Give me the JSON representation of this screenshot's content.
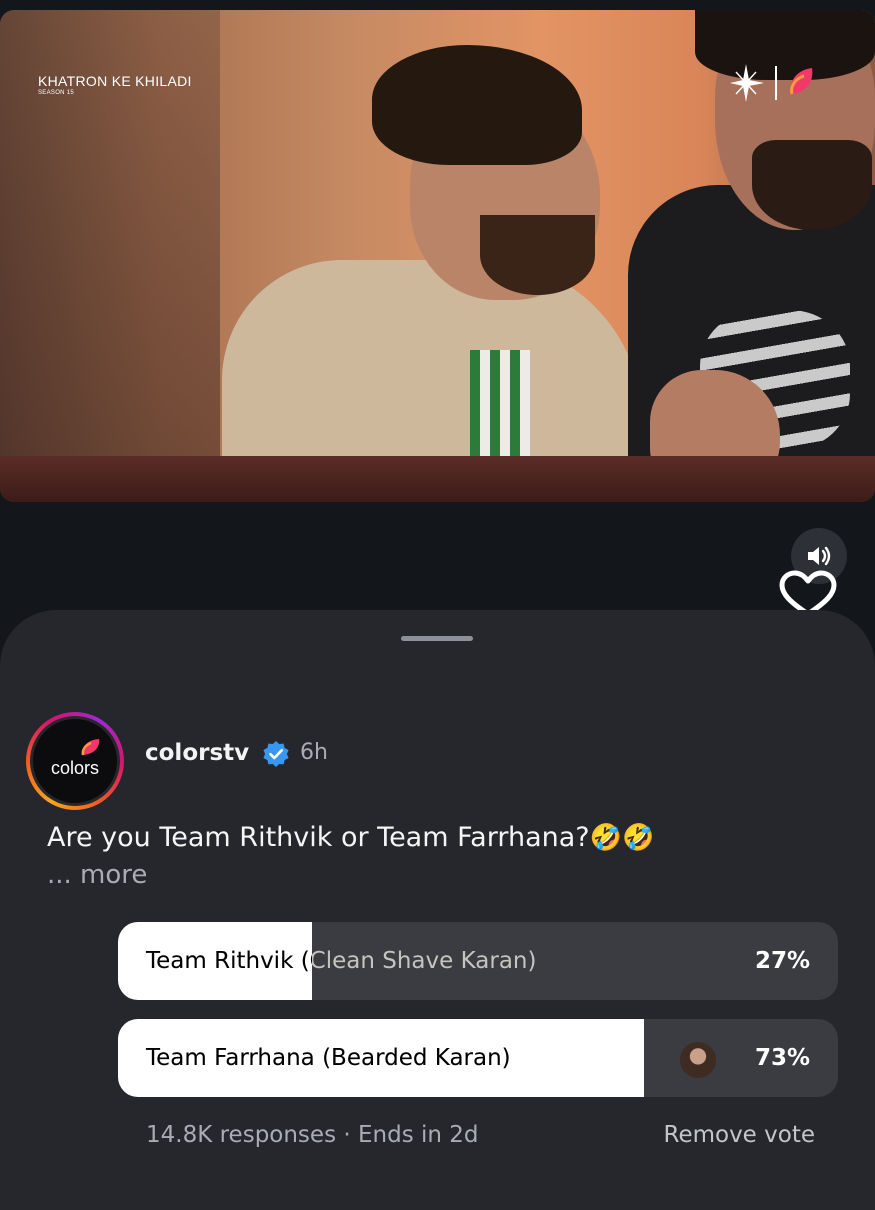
{
  "video": {
    "show_title": "KHATRON KE KHILADI",
    "show_season": "SEASON 15"
  },
  "post": {
    "username": "colorstv",
    "avatar_text": "colors",
    "time_ago": "6h",
    "caption": "Are you Team Rithvik or Team Farrhana?",
    "caption_emojis": "🤣🤣",
    "more_label": "... more"
  },
  "poll": {
    "options": [
      {
        "label": "Team Rithvik (Clean Shave Karan)",
        "percent_label": "27%",
        "percent": 27,
        "selected": false
      },
      {
        "label": "Team Farrhana (Bearded Karan)",
        "percent_label": "73%",
        "percent": 73,
        "selected": true
      }
    ],
    "responses": "14.8K responses · Ends in 2d",
    "remove_vote_label": "Remove vote"
  },
  "icons": {
    "mute": "speaker-icon",
    "like": "heart-icon",
    "verified": "verified-badge-icon",
    "channel_logo": "colors-logo-icon"
  },
  "colors": {
    "background": "#13161b",
    "sheet": "#25272c",
    "poll_fill": "#ffffff",
    "poll_track": "#3a3c41",
    "verified_blue": "#3897f0"
  }
}
